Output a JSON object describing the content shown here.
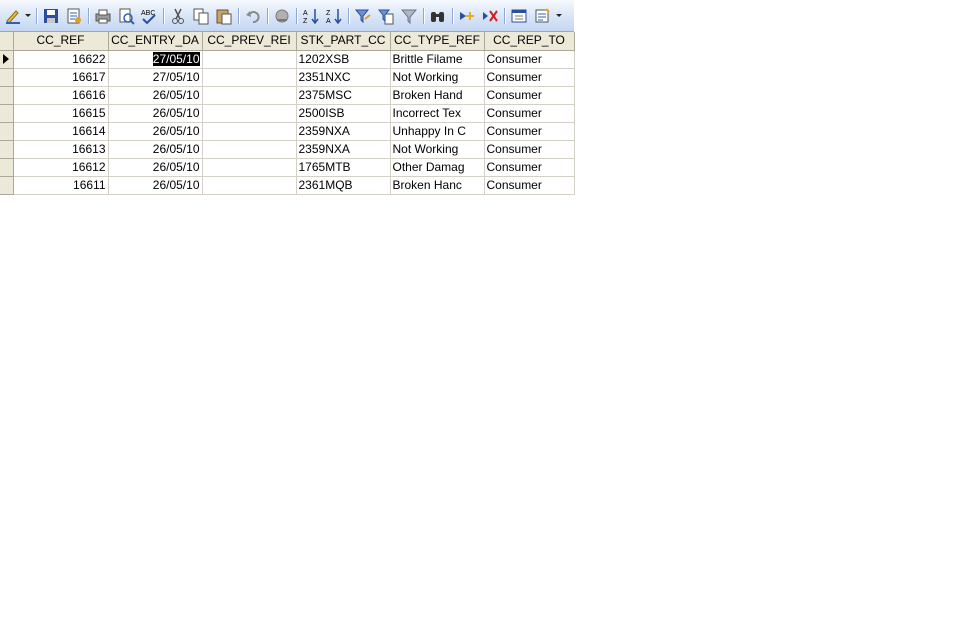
{
  "toolbar": {
    "icons": [
      "design-pencil",
      "save",
      "properties",
      "print",
      "print-preview",
      "spell-check",
      "cut",
      "copy",
      "paste",
      "undo",
      "insert-hyperlink",
      "sort-ascending",
      "sort-descending",
      "filter-by-selection",
      "filter-by-form",
      "apply-filter",
      "find",
      "new-record",
      "delete-record",
      "database-window",
      "new-object"
    ]
  },
  "grid": {
    "columns": [
      "CC_REF",
      "CC_ENTRY_DA",
      "CC_PREV_REI",
      "STK_PART_CC",
      "CC_TYPE_REF",
      "CC_REP_TO"
    ],
    "rows": [
      {
        "ref": "16622",
        "entry": "27/05/10",
        "prev": "",
        "part": "1202XSB",
        "type": "Brittle Filame",
        "rep": "Consumer"
      },
      {
        "ref": "16617",
        "entry": "27/05/10",
        "prev": "",
        "part": "2351NXC",
        "type": "Not Working",
        "rep": "Consumer"
      },
      {
        "ref": "16616",
        "entry": "26/05/10",
        "prev": "",
        "part": "2375MSC",
        "type": "Broken Hand",
        "rep": "Consumer"
      },
      {
        "ref": "16615",
        "entry": "26/05/10",
        "prev": "",
        "part": "2500ISB",
        "type": "Incorrect Tex",
        "rep": "Consumer"
      },
      {
        "ref": "16614",
        "entry": "26/05/10",
        "prev": "",
        "part": "2359NXA",
        "type": "Unhappy In C",
        "rep": "Consumer"
      },
      {
        "ref": "16613",
        "entry": "26/05/10",
        "prev": "",
        "part": "2359NXA",
        "type": "Not Working",
        "rep": "Consumer"
      },
      {
        "ref": "16612",
        "entry": "26/05/10",
        "prev": "",
        "part": "1765MTB",
        "type": "Other Damag",
        "rep": "Consumer"
      },
      {
        "ref": "16611",
        "entry": "26/05/10",
        "prev": "",
        "part": "2361MQB",
        "type": "Broken Hanc",
        "rep": "Consumer"
      }
    ]
  }
}
